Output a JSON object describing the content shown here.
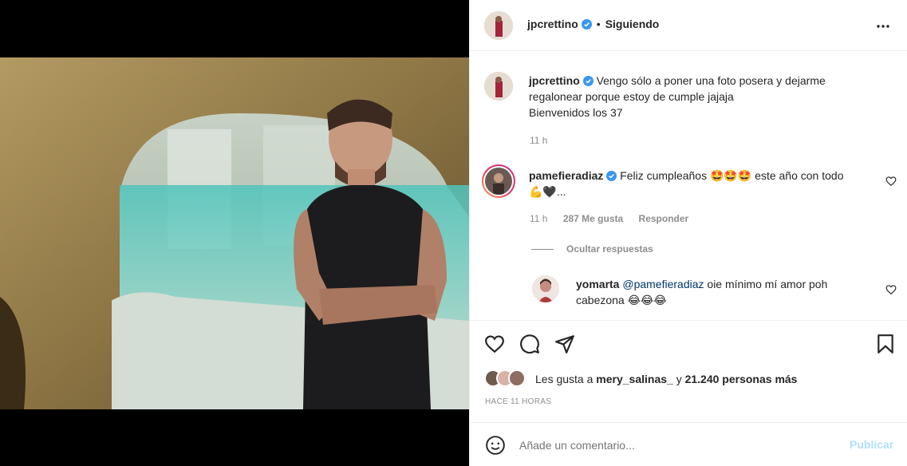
{
  "post": {
    "author": "jpcrettino",
    "follow_state": "Siguiendo",
    "caption_line1": "Vengo sólo a poner una foto posera y dejarme",
    "caption_line2": "regalonear porque estoy de cumple jajaja",
    "caption_line3": "Bienvenidos los 37",
    "caption_time": "11 h"
  },
  "comments": [
    {
      "user": "pamefieradiaz",
      "text_line1": "Feliz cumpleaños 🤩🤩🤩 este año con todo",
      "text_line2": "💪🖤...",
      "time": "11 h",
      "likes": "287 Me gusta",
      "reply": "Responder",
      "hide_replies": "Ocultar respuestas"
    }
  ],
  "reply": {
    "user": "yomarta",
    "mention": "@pamefieradiaz",
    "text_line1": " oie mínimo mí amor poh",
    "text_line2": "cabezona 😂😂😂"
  },
  "likes": {
    "prefix": "Les gusta a ",
    "user": "mery_salinas_",
    "conj": " y ",
    "others": "21.240 personas más"
  },
  "timestamp": "HACE 11 HORAS",
  "comment_box": {
    "placeholder": "Añade un comentario...",
    "publish": "Publicar"
  },
  "colors": {
    "verified": "#3897f0",
    "publish_disabled": "#b2dffc",
    "border": "#efefef",
    "secondary_text": "#8e8e8e"
  },
  "icons": [
    "more-options-icon",
    "heart-icon",
    "comment-icon",
    "share-icon",
    "bookmark-icon",
    "emoji-icon",
    "verified-icon",
    "like-comment-icon"
  ]
}
